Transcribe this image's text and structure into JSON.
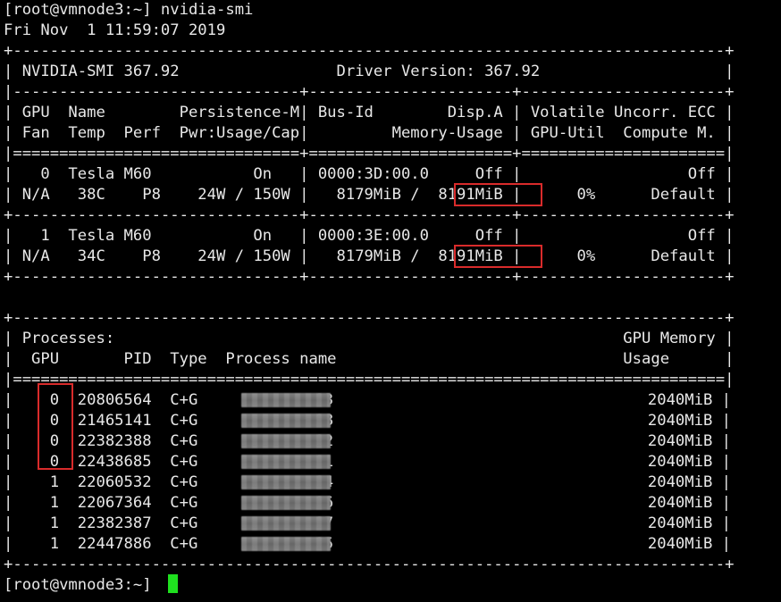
{
  "terminal": {
    "command_line": "[root@vmnode3:~] nvidia-smi",
    "timestamp": "Fri Nov  1 11:59:07 2019",
    "border_top": "+-----------------------------------------------------------------------------+",
    "header_line": "| NVIDIA-SMI 367.92                 Driver Version: 367.92                    |",
    "sep_dash": "|-------------------------------+----------------------+----------------------+",
    "col_header_1": "| GPU  Name        Persistence-M| Bus-Id        Disp.A | Volatile Uncorr. ECC |",
    "col_header_2": "| Fan  Temp  Perf  Pwr:Usage/Cap|         Memory-Usage | GPU-Util  Compute M. |",
    "sep_eq": "|===============================+======================+======================|",
    "gpu0_line1": "|   0  Tesla M60           On   | 0000:3D:00.0     Off |                  Off |",
    "gpu0_line2": "| N/A   38C    P8    24W / 150W |   8179MiB /  8191MiB |      0%      Default |",
    "gpu_border": "+-------------------------------+----------------------+----------------------+",
    "gpu1_line1": "|   1  Tesla M60           On   | 0000:3E:00.0     Off |                  Off |",
    "gpu1_line2": "| N/A   34C    P8    24W / 150W |   8179MiB /  8191MiB |      0%      Default |",
    "proc_border_top": "+-----------------------------------------------------------------------------+",
    "proc_header_1": "| Processes:                                                       GPU Memory |",
    "proc_header_2": "|  GPU       PID  Type  Process name                               Usage      |",
    "proc_sep_eq": "|=============================================================================|",
    "processes": [
      {
        "line_left": "|    0  20806564  C+G   ",
        "name_suffix": "03",
        "line_right": "                                  2040MiB |"
      },
      {
        "line_left": "|    0  21465141  C+G   ",
        "name_suffix": "08",
        "line_right": "                                  2040MiB |"
      },
      {
        "line_left": "|    0  22382388  C+G   ",
        "name_suffix": "02",
        "line_right": "                                  2040MiB |"
      },
      {
        "line_left": "|    0  22438685  C+G   ",
        "name_suffix": "01",
        "line_right": "                                  2040MiB |"
      },
      {
        "line_left": "|    1  22060532  C+G   ",
        "name_suffix": "04",
        "line_right": "                                  2040MiB |"
      },
      {
        "line_left": "|    1  22067364  C+G   ",
        "name_suffix": "06",
        "line_right": "                                  2040MiB |"
      },
      {
        "line_left": "|    1  22382387  C+G   ",
        "name_suffix": "07",
        "line_right": "                                  2040MiB |"
      },
      {
        "line_left": "|    1  22447886  C+G   ",
        "name_suffix": "05",
        "line_right": "                                  2040MiB |"
      }
    ],
    "proc_border_bottom": "+-----------------------------------------------------------------------------+",
    "prompt": "[root@vmnode3:~] "
  },
  "colors": {
    "background": "#000000",
    "text": "#e8e8e8",
    "highlight_box": "#d92b2b",
    "cursor": "#1fe01f"
  }
}
